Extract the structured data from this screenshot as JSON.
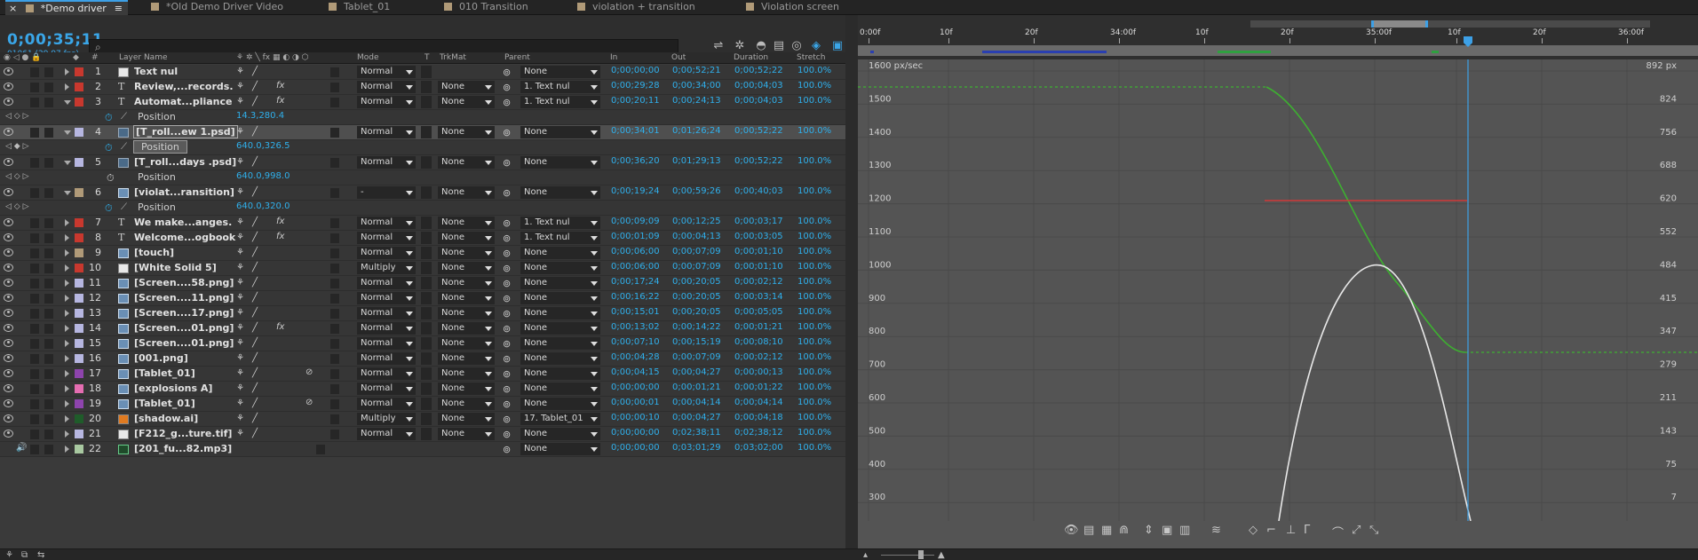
{
  "tabs": [
    {
      "label": "*Demo driver",
      "active": true
    },
    {
      "label": "*Old Demo Driver Video"
    },
    {
      "label": "Tablet_01"
    },
    {
      "label": "010 Transition"
    },
    {
      "label": "violation + transition"
    },
    {
      "label": "Violation screen"
    }
  ],
  "timecode": "0;00;35;11",
  "fps": "01061 (29.97 fps)",
  "search": {
    "icon": "search-icon",
    "value": ""
  },
  "columns": {
    "layer_name": "Layer Name",
    "mode": "Mode",
    "t": "T",
    "trkmat": "TrkMat",
    "parent": "Parent",
    "in": "In",
    "out": "Out",
    "duration": "Duration",
    "stretch": "Stretch",
    "num": "#"
  },
  "layers": [
    {
      "n": "1",
      "color": "#c8382e",
      "icon": "white",
      "name": "Text nul",
      "mode": "Normal",
      "trk": "",
      "parent": "None",
      "in": "0;00;00;00",
      "out": "0;00;52;21",
      "dur": "0;00;52;22",
      "str": "100.0%"
    },
    {
      "n": "2",
      "color": "#c8382e",
      "icon": "T",
      "name": "Review,...records.",
      "mode": "Normal",
      "trk": "None",
      "parent": "1. Text nul",
      "in": "0;00;29;28",
      "out": "0;00;34;00",
      "dur": "0;00;04;03",
      "str": "100.0%",
      "fx": true
    },
    {
      "n": "3",
      "color": "#c8382e",
      "icon": "T",
      "name": "Automat...pliance",
      "mode": "Normal",
      "trk": "None",
      "parent": "1. Text nul",
      "in": "0;00;20;11",
      "out": "0;00;24;13",
      "dur": "0;00;04;03",
      "str": "100.0%",
      "fx": true,
      "open": true
    },
    {
      "prop": true,
      "name": "Position",
      "value": "14.3,280.4"
    },
    {
      "n": "4",
      "color": "#b6b6e0",
      "icon": "comp",
      "name": "[T_roll...ew 1.psd]",
      "mode": "Normal",
      "trk": "None",
      "parent": "None",
      "in": "0;00;34;01",
      "out": "0;01;26;24",
      "dur": "0;00;52;22",
      "str": "100.0%",
      "sel": true,
      "open": true
    },
    {
      "prop": true,
      "name": "Position",
      "value": "640.0,326.5",
      "sel": true
    },
    {
      "n": "5",
      "color": "#b6b6e0",
      "icon": "comp",
      "name": "[T_roll...days .psd]",
      "mode": "Normal",
      "trk": "None",
      "parent": "None",
      "in": "0;00;36;20",
      "out": "0;01;29;13",
      "dur": "0;00;52;22",
      "str": "100.0%",
      "open": true
    },
    {
      "prop": true,
      "name": "Position",
      "value": "640.0,998.0",
      "nostop": true
    },
    {
      "n": "6",
      "color": "#b09a78",
      "icon": "img",
      "name": "[violat...ransition]",
      "mode": "-",
      "trk": "None",
      "parent": "None",
      "in": "0;00;19;24",
      "out": "0;00;59;26",
      "dur": "0;00;40;03",
      "str": "100.0%",
      "open": true
    },
    {
      "prop": true,
      "name": "Position",
      "value": "640.0,320.0"
    },
    {
      "n": "7",
      "color": "#c8382e",
      "icon": "T",
      "name": "We make...anges.",
      "mode": "Normal",
      "trk": "None",
      "parent": "1. Text nul",
      "in": "0;00;09;09",
      "out": "0;00;12;25",
      "dur": "0;00;03;17",
      "str": "100.0%",
      "fx": true
    },
    {
      "n": "8",
      "color": "#c8382e",
      "icon": "T",
      "name": "Welcome...ogbook",
      "mode": "Normal",
      "trk": "None",
      "parent": "1. Text nul",
      "in": "0;00;01;09",
      "out": "0;00;04;13",
      "dur": "0;00;03;05",
      "str": "100.0%",
      "fx": true
    },
    {
      "n": "9",
      "color": "#b09a78",
      "icon": "img",
      "name": "[touch]",
      "mode": "Normal",
      "trk": "None",
      "parent": "None",
      "in": "0;00;06;00",
      "out": "0;00;07;09",
      "dur": "0;00;01;10",
      "str": "100.0%"
    },
    {
      "n": "10",
      "color": "#c8382e",
      "icon": "white",
      "name": "[White Solid 5]",
      "mode": "Multiply",
      "trk": "None",
      "parent": "None",
      "in": "0;00;06;00",
      "out": "0;00;07;09",
      "dur": "0;00;01;10",
      "str": "100.0%"
    },
    {
      "n": "11",
      "color": "#b6b6e0",
      "icon": "img",
      "name": "[Screen....58.png]",
      "mode": "Normal",
      "trk": "None",
      "parent": "None",
      "in": "0;00;17;24",
      "out": "0;00;20;05",
      "dur": "0;00;02;12",
      "str": "100.0%"
    },
    {
      "n": "12",
      "color": "#b6b6e0",
      "icon": "img",
      "name": "[Screen....11.png]",
      "mode": "Normal",
      "trk": "None",
      "parent": "None",
      "in": "0;00;16;22",
      "out": "0;00;20;05",
      "dur": "0;00;03;14",
      "str": "100.0%"
    },
    {
      "n": "13",
      "color": "#b6b6e0",
      "icon": "img",
      "name": "[Screen....17.png]",
      "mode": "Normal",
      "trk": "None",
      "parent": "None",
      "in": "0;00;15;01",
      "out": "0;00;20;05",
      "dur": "0;00;05;05",
      "str": "100.0%"
    },
    {
      "n": "14",
      "color": "#b6b6e0",
      "icon": "img",
      "name": "[Screen....01.png]",
      "mode": "Normal",
      "trk": "None",
      "parent": "None",
      "in": "0;00;13;02",
      "out": "0;00;14;22",
      "dur": "0;00;01;21",
      "str": "100.0%",
      "fx": true
    },
    {
      "n": "15",
      "color": "#b6b6e0",
      "icon": "img",
      "name": "[Screen....01.png]",
      "mode": "Normal",
      "trk": "None",
      "parent": "None",
      "in": "0;00;07;10",
      "out": "0;00;15;19",
      "dur": "0;00;08;10",
      "str": "100.0%"
    },
    {
      "n": "16",
      "color": "#b6b6e0",
      "icon": "img",
      "name": "[001.png]",
      "mode": "Normal",
      "trk": "None",
      "parent": "None",
      "in": "0;00;04;28",
      "out": "0;00;07;09",
      "dur": "0;00;02;12",
      "str": "100.0%"
    },
    {
      "n": "17",
      "color": "#8e44ad",
      "icon": "img",
      "name": "[Tablet_01]",
      "mode": "Normal",
      "trk": "None",
      "parent": "None",
      "in": "0;00;04;15",
      "out": "0;00;04;27",
      "dur": "0;00;00;13",
      "str": "100.0%",
      "link": true
    },
    {
      "n": "18",
      "color": "#e56db1",
      "icon": "img",
      "name": "[explosions A]",
      "mode": "Normal",
      "trk": "None",
      "parent": "None",
      "in": "0;00;00;00",
      "out": "0;00;01;21",
      "dur": "0;00;01;22",
      "str": "100.0%"
    },
    {
      "n": "19",
      "color": "#8e44ad",
      "icon": "img",
      "name": "[Tablet_01]",
      "mode": "Normal",
      "trk": "None",
      "parent": "None",
      "in": "0;00;00;01",
      "out": "0;00;04;14",
      "dur": "0;00;04;14",
      "str": "100.0%",
      "link": true
    },
    {
      "n": "20",
      "color": "#1f5c2a",
      "icon": "ai",
      "name": "[shadow.ai]",
      "mode": "Multiply",
      "trk": "None",
      "parent": "17. Tablet_01",
      "in": "0;00;00;10",
      "out": "0;00;04;27",
      "dur": "0;00;04;18",
      "str": "100.0%"
    },
    {
      "n": "21",
      "color": "#b6b6e0",
      "icon": "white",
      "name": "[F212_g...ture.tif]",
      "mode": "Normal",
      "trk": "None",
      "parent": "None",
      "in": "0;00;00;00",
      "out": "0;02;38;11",
      "dur": "0;02;38;12",
      "str": "100.0%"
    },
    {
      "n": "22",
      "color": "#a8c8a0",
      "icon": "au",
      "name": "[201_fu...82.mp3]",
      "mode": "",
      "trk": "",
      "parent": "None",
      "in": "0;00;00;00",
      "out": "0;03;01;29",
      "dur": "0;03;02;00",
      "str": "100.0%",
      "audio": true
    }
  ],
  "ruler": {
    "labels": [
      "0:00f",
      "10f",
      "20f",
      "34:00f",
      "10f",
      "20f",
      "35:00f",
      "10f",
      "20f",
      "36:00f"
    ]
  },
  "graph": {
    "left_axis": [
      "1600 px/sec",
      "1500",
      "1400",
      "1300",
      "1200",
      "1100",
      "1000",
      "900",
      "800",
      "700",
      "600",
      "500",
      "400",
      "300"
    ],
    "right_axis": [
      "892 px",
      "824",
      "756",
      "688",
      "620",
      "552",
      "484",
      "415",
      "347",
      "279",
      "211",
      "143",
      "75",
      "7"
    ]
  },
  "graph_tools": [
    "eye-icon",
    "list-icon",
    "grid-icon",
    "snap-icon",
    "zoom-fit-icon",
    "fit-selection-icon",
    "fit-all-icon",
    "separate-dimensions-icon",
    "edit-keyframe-icon",
    "convert-keyframe-icon",
    "hold-keyframe-icon",
    "easy-ease-icon",
    "ease-in-icon",
    "ease-out-icon"
  ],
  "colors": {
    "accent": "#2fb0ec",
    "green": "#3db030",
    "red": "#d03838"
  }
}
